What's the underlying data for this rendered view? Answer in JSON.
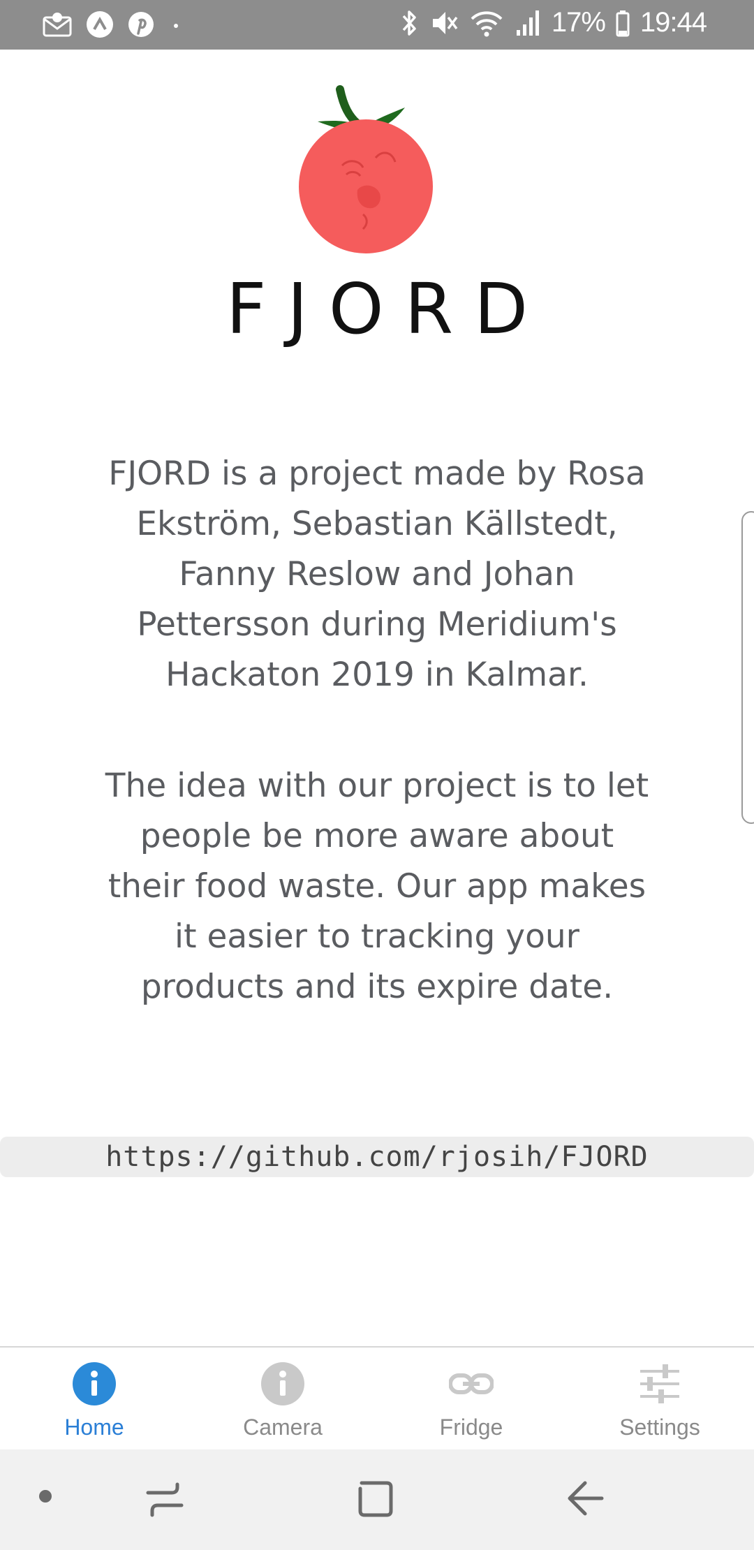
{
  "status_bar": {
    "battery_percent": "17%",
    "time": "19:44",
    "left_icons": [
      "mail-icon",
      "arrow-up-circle-icon",
      "pinterest-icon",
      "dot-icon"
    ],
    "right_icons": [
      "bluetooth-icon",
      "mute-icon",
      "wifi-icon",
      "signal-icon",
      "battery-icon"
    ]
  },
  "app": {
    "logo_icon": "tomato-logo-icon",
    "title": "FJORD",
    "paragraph1": "FJORD is a project made by Rosa Ekström, Sebastian Källstedt, Fanny Reslow and Johan Pettersson during Meridium's Hackaton 2019 in Kalmar.",
    "paragraph2": "The idea with our project is to let people be more aware about their food waste. Our app makes it easier to tracking your products and its expire date.",
    "link": "https://github.com/rjosih/FJORD"
  },
  "tabs": [
    {
      "label": "Home",
      "icon": "info-icon",
      "active": true
    },
    {
      "label": "Camera",
      "icon": "info-icon",
      "active": false
    },
    {
      "label": "Fridge",
      "icon": "link-icon",
      "active": false
    },
    {
      "label": "Settings",
      "icon": "sliders-icon",
      "active": false
    }
  ],
  "colors": {
    "active_tab": "#2b7fd6",
    "inactive_tab": "#8a8a8a",
    "status_bar": "#8d8d8d",
    "tomato": "#f55c5c"
  },
  "system_nav": [
    "dot-button",
    "recents-button",
    "home-button",
    "back-button"
  ]
}
